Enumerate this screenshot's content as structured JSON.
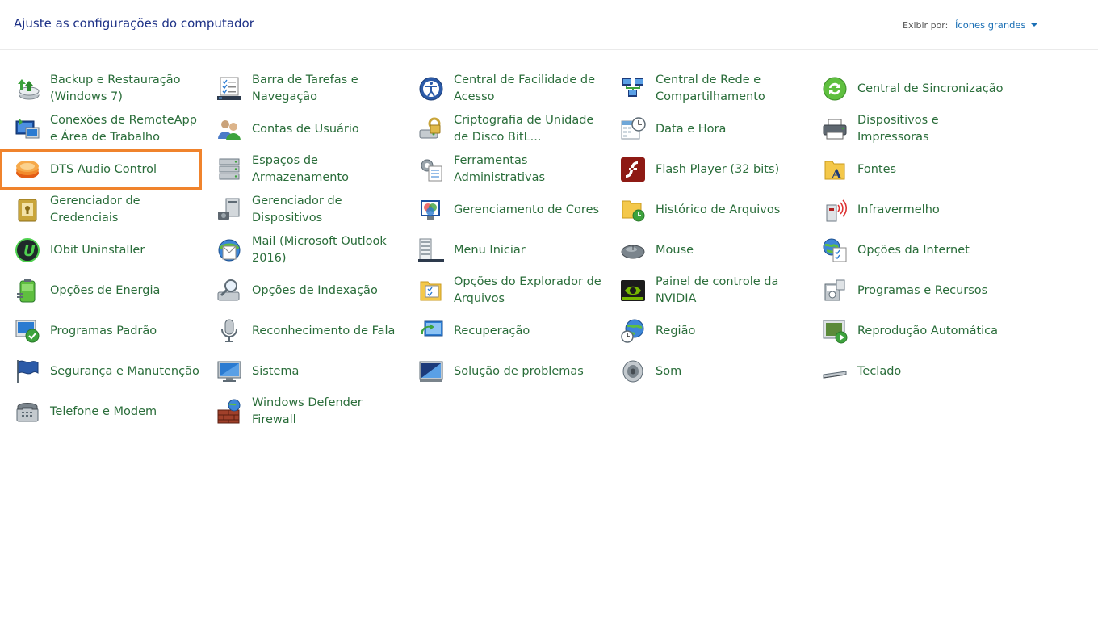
{
  "header": {
    "title": "Ajuste as configurações do computador",
    "view_by_label": "Exibir por:",
    "view_by_value": "Ícones grandes"
  },
  "items": [
    {
      "label": "Backup e Restauração (Windows 7)",
      "icon": "backup-icon"
    },
    {
      "label": "Barra de Tarefas e Navegação",
      "icon": "taskbar-icon"
    },
    {
      "label": "Central de Facilidade de Acesso",
      "icon": "ease-of-access-icon"
    },
    {
      "label": "Central de Rede e Compartilhamento",
      "icon": "network-icon"
    },
    {
      "label": "Central de Sincronização",
      "icon": "sync-icon"
    },
    {
      "label": "Conexões de RemoteApp e Área de Trabalho",
      "icon": "remoteapp-icon"
    },
    {
      "label": "Contas de Usuário",
      "icon": "user-accounts-icon"
    },
    {
      "label": "Criptografia de Unidade de Disco BitL...",
      "icon": "bitlocker-icon"
    },
    {
      "label": "Data e Hora",
      "icon": "calendar-clock-icon"
    },
    {
      "label": "Dispositivos e Impressoras",
      "icon": "printer-icon"
    },
    {
      "label": "DTS Audio Control",
      "icon": "dts-audio-icon"
    },
    {
      "label": "Espaços de Armazenamento",
      "icon": "storage-spaces-icon"
    },
    {
      "label": "Ferramentas Administrativas",
      "icon": "admin-tools-icon"
    },
    {
      "label": "Flash Player (32 bits)",
      "icon": "flash-icon"
    },
    {
      "label": "Fontes",
      "icon": "fonts-icon"
    },
    {
      "label": "Gerenciador de Credenciais",
      "icon": "credentials-icon"
    },
    {
      "label": "Gerenciador de Dispositivos",
      "icon": "device-manager-icon"
    },
    {
      "label": "Gerenciamento de Cores",
      "icon": "color-management-icon"
    },
    {
      "label": "Histórico de Arquivos",
      "icon": "file-history-icon"
    },
    {
      "label": "Infravermelho",
      "icon": "infrared-icon"
    },
    {
      "label": "IObit Uninstaller",
      "icon": "iobit-icon"
    },
    {
      "label": "Mail (Microsoft Outlook 2016)",
      "icon": "mail-icon"
    },
    {
      "label": "Menu Iniciar",
      "icon": "start-menu-icon"
    },
    {
      "label": "Mouse",
      "icon": "mouse-icon"
    },
    {
      "label": "Opções da Internet",
      "icon": "internet-options-icon"
    },
    {
      "label": "Opções de Energia",
      "icon": "power-icon"
    },
    {
      "label": "Opções de Indexação",
      "icon": "indexing-icon"
    },
    {
      "label": "Opções do Explorador de Arquivos",
      "icon": "folder-options-icon"
    },
    {
      "label": "Painel de controle da NVIDIA",
      "icon": "nvidia-icon"
    },
    {
      "label": "Programas e Recursos",
      "icon": "programs-icon"
    },
    {
      "label": "Programas Padrão",
      "icon": "default-programs-icon"
    },
    {
      "label": "Reconhecimento de Fala",
      "icon": "microphone-icon"
    },
    {
      "label": "Recuperação",
      "icon": "recovery-icon"
    },
    {
      "label": "Região",
      "icon": "globe-clock-icon"
    },
    {
      "label": "Reprodução Automática",
      "icon": "autoplay-icon"
    },
    {
      "label": "Segurança e Manutenção",
      "icon": "flag-icon"
    },
    {
      "label": "Sistema",
      "icon": "computer-icon"
    },
    {
      "label": "Solução de problemas",
      "icon": "troubleshooting-icon"
    },
    {
      "label": "Som",
      "icon": "speaker-icon"
    },
    {
      "label": "Teclado",
      "icon": "keyboard-icon"
    },
    {
      "label": "Telefone e Modem",
      "icon": "phone-modem-icon"
    },
    {
      "label": "Windows Defender Firewall",
      "icon": "firewall-icon"
    }
  ],
  "selected_item": "DTS Audio Control",
  "colors": {
    "title": "#1e3287",
    "link": "#2a6d3a",
    "selection_outline": "#f0832c",
    "view_by_value": "#1a6fb5"
  }
}
